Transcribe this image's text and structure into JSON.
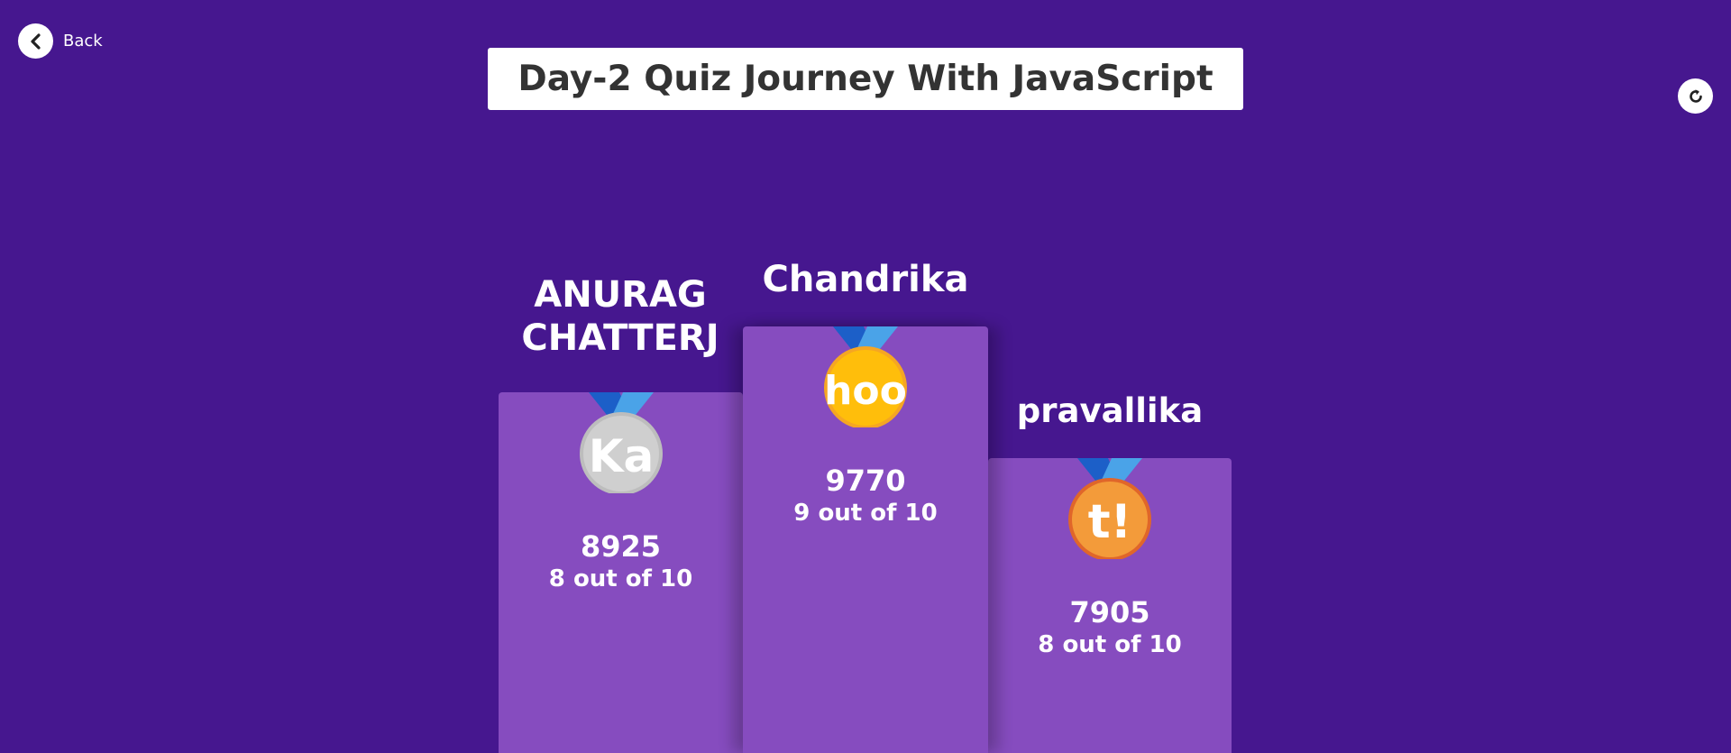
{
  "header": {
    "back_label": "Back",
    "title": "Day-2 Quiz Journey With JavaScript"
  },
  "podium": [
    {
      "rank": 2,
      "name": "ANURAG\nCHATTERJ",
      "medal": "silver",
      "medal_letters": "Ka",
      "score": "8925",
      "correct": "8 out of 10"
    },
    {
      "rank": 1,
      "name": "Chandrika",
      "medal": "gold",
      "medal_letters": "hoo",
      "score": "9770",
      "correct": "9 out of 10"
    },
    {
      "rank": 3,
      "name": "pravallika",
      "medal": "bronze",
      "medal_letters": "t!",
      "score": "7905",
      "correct": "8 out of 10"
    }
  ],
  "colors": {
    "background": "#46178f",
    "podium": "#864cbf",
    "gold": "#ffbe0b",
    "silver": "#cccccc",
    "bronze": "#f39b3a",
    "ribbon_dark": "#1c5fc8",
    "ribbon_light": "#4aa3e8"
  },
  "icons": {
    "back": "chevron-left-icon",
    "refresh": "refresh-icon"
  }
}
